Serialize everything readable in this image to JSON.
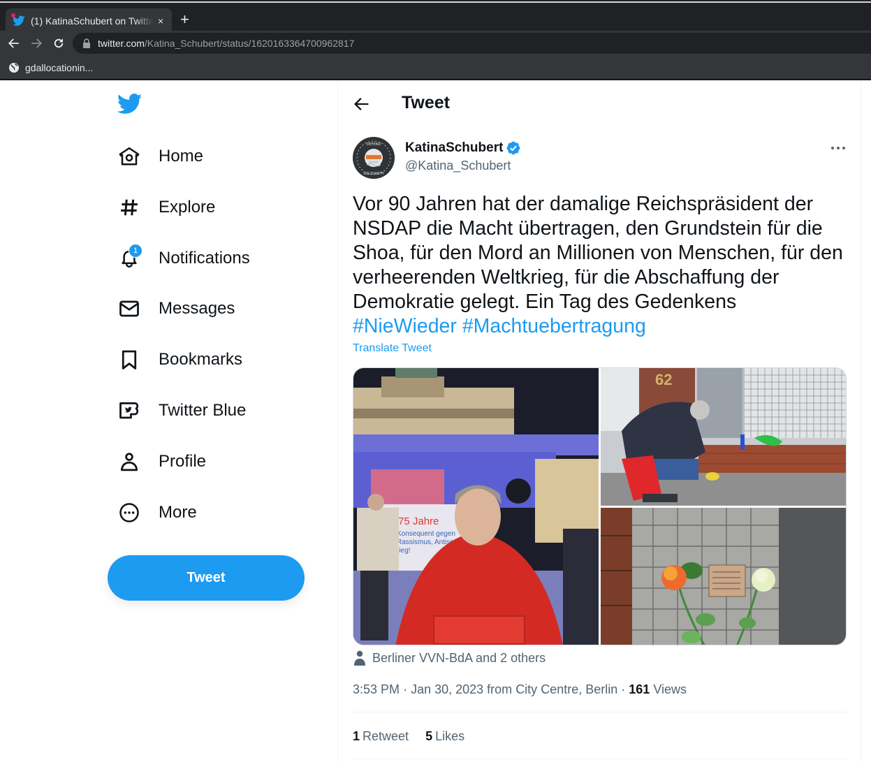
{
  "browser": {
    "tab_title": "(1) KatinaSchubert on Twitter",
    "tab_close": "×",
    "new_tab": "+",
    "url_host": "twitter.com",
    "url_path": "/Katina_Schubert/status/1620163364700962817",
    "bookmark_label": "gdallocationin..."
  },
  "sidebar": {
    "items": [
      {
        "label": "Home",
        "icon": "home-icon"
      },
      {
        "label": "Explore",
        "icon": "hashtag-icon"
      },
      {
        "label": "Notifications",
        "icon": "bell-icon",
        "badge": "1"
      },
      {
        "label": "Messages",
        "icon": "envelope-icon"
      },
      {
        "label": "Bookmarks",
        "icon": "bookmark-icon"
      },
      {
        "label": "Twitter Blue",
        "icon": "twitter-blue-icon"
      },
      {
        "label": "Profile",
        "icon": "person-icon"
      },
      {
        "label": "More",
        "icon": "more-circle-icon"
      }
    ],
    "tweet_button": "Tweet"
  },
  "header": {
    "title": "Tweet"
  },
  "tweet": {
    "display_name": "KatinaSchubert",
    "handle": "@Katina_Schubert",
    "verified": true,
    "text": "Vor 90 Jahren hat der damalige Reichspräsident der NSDAP die Macht übertragen, den Grundstein für die Shoa, für den Mord an Millionen von Menschen, für den verheerenden Weltkrieg, für die Abschaffung der Demokratie gelegt. Ein Tag des Gedenkens",
    "hashtags": [
      "#NieWieder",
      "#Machtuebertragung"
    ],
    "translate_label": "Translate Tweet",
    "media": [
      {
        "alt": "Woman in red rain poncho at night in front of Brandenburg Gate with banner '75 Jahre Konsequent gegen Rassismus, Antisemitismus und Krieg!'",
        "banner_text_1": "75 Jahre",
        "banner_text_2": "Konsequent gegen",
        "banner_text_3": "Rassismus, Antise",
        "banner_text_4": "rieg!"
      },
      {
        "alt": "Woman crouching to clean a Stolperstein in front of house number 62",
        "house_number": "62"
      },
      {
        "alt": "Stolperstein on cobblestones with an orange rose and a white rose"
      }
    ],
    "tagged_people": "Berliner VVN-BdA and 2 others",
    "time": "3:53 PM",
    "date": "Jan 30, 2023",
    "location_prefix": "from",
    "location": "City Centre, Berlin",
    "views_count": "161",
    "views_label": "Views",
    "retweets_count": "1",
    "retweets_label": "Retweet",
    "likes_count": "5",
    "likes_label": "Likes"
  },
  "colors": {
    "accent": "#1d9bf0",
    "text_primary": "#0f1419",
    "text_secondary": "#536471",
    "chrome_dark": "#202124",
    "chrome_mid": "#35363a"
  }
}
